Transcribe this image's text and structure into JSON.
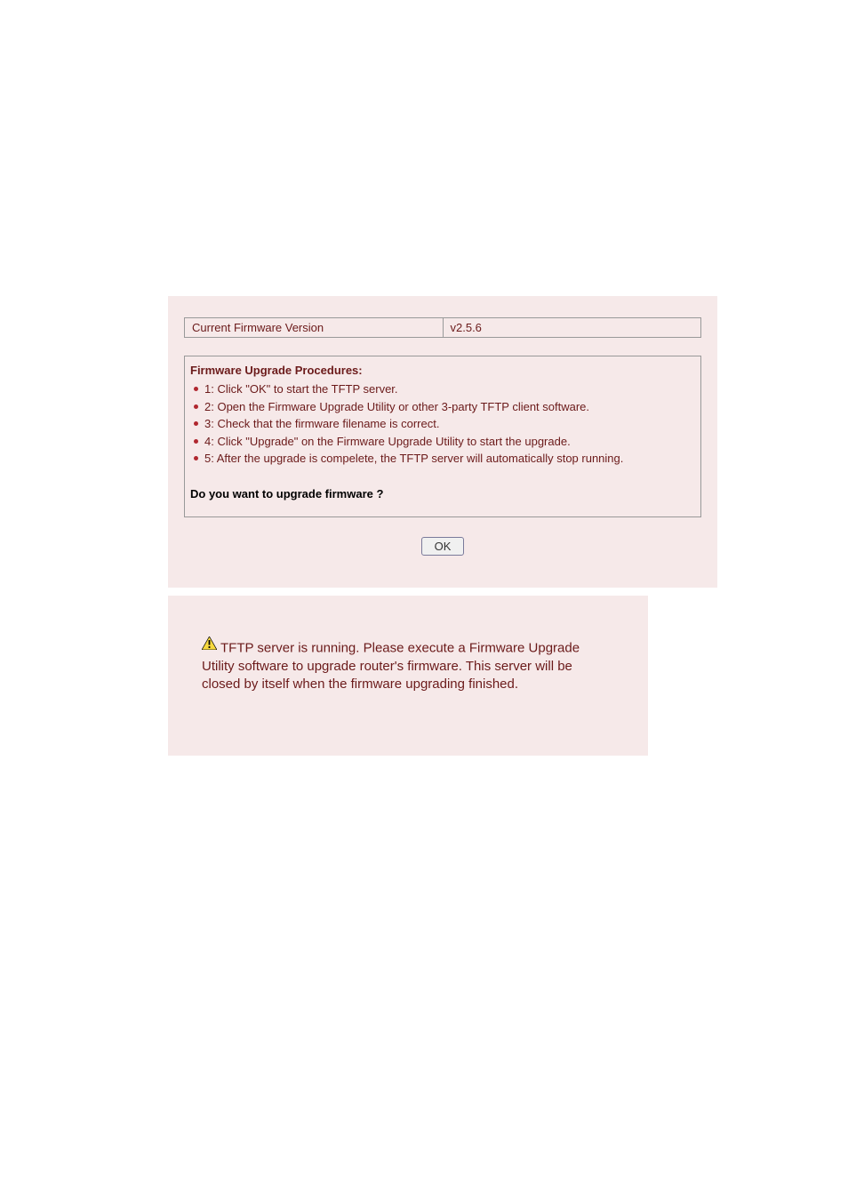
{
  "version_row": {
    "label": "Current Firmware Version",
    "value": "v2.5.6"
  },
  "procedures": {
    "title": "Firmware Upgrade Procedures:",
    "steps": [
      "1: Click \"OK\" to start the TFTP server.",
      "2: Open the Firmware Upgrade Utility or other 3-party TFTP client software.",
      "3: Check that the firmware filename is correct.",
      "4: Click \"Upgrade\" on the Firmware Upgrade Utility to start the upgrade.",
      "5: After the upgrade is compelete, the TFTP server will automatically stop running."
    ],
    "confirm": "Do you want to upgrade firmware ?"
  },
  "buttons": {
    "ok": "OK"
  },
  "status": {
    "message": "TFTP server is running. Please execute a Firmware Upgrade Utility software to upgrade router's firmware. This server will be closed by itself when the firmware upgrading finished."
  }
}
